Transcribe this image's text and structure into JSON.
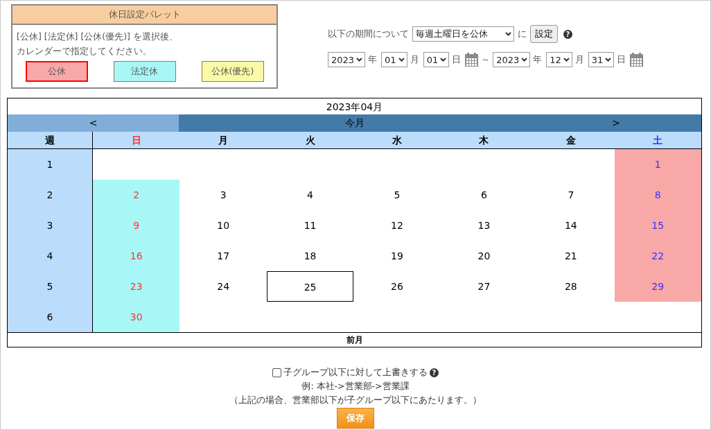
{
  "palette": {
    "title": "休日設定パレット",
    "instructions": [
      "[公休] [法定休] [公休(優先)] を選択後、",
      "カレンダーで指定してください。"
    ],
    "items": [
      {
        "kind": "public",
        "label": "公休",
        "color": "#f9a8a8",
        "selected": true
      },
      {
        "kind": "legal",
        "label": "法定休",
        "color": "#a8f7f7",
        "selected": false
      },
      {
        "kind": "priority",
        "label": "公休(優先)",
        "color": "#fafaa6",
        "selected": false
      }
    ]
  },
  "period": {
    "label": "以下の期間について",
    "rule": "毎週土曜日を公休",
    "connector": "に",
    "set_button": "設定",
    "help": "?",
    "start": [
      {
        "value": "2023",
        "unit": "年"
      },
      {
        "value": "01",
        "unit": "月"
      },
      {
        "value": "01",
        "unit": "日"
      }
    ],
    "separator": "～",
    "end": [
      {
        "value": "2023",
        "unit": "年"
      },
      {
        "value": "12",
        "unit": "月"
      },
      {
        "value": "31",
        "unit": "日"
      }
    ]
  },
  "calendar": {
    "title": "2023年04月",
    "prev": "<",
    "today_button": "今月",
    "next": ">",
    "week_header": "週",
    "weekdays": [
      {
        "kind": "sun",
        "label": "日",
        "color": "#ff3333"
      },
      {
        "kind": "mon",
        "label": "月",
        "color": "#000000"
      },
      {
        "kind": "tue",
        "label": "火",
        "color": "#000000"
      },
      {
        "kind": "wed",
        "label": "水",
        "color": "#000000"
      },
      {
        "kind": "thu",
        "label": "木",
        "color": "#000000"
      },
      {
        "kind": "fri",
        "label": "金",
        "color": "#000000"
      },
      {
        "kind": "sat",
        "label": "土",
        "color": "#3333ff"
      }
    ],
    "weeks": [
      {
        "week": "1",
        "days": [
          {
            "kind": "sat",
            "day": "1",
            "public_holiday": true,
            "legal_holiday": false,
            "today": false
          }
        ]
      },
      {
        "week": "2",
        "days": [
          {
            "kind": "sun",
            "day": "2",
            "public_holiday": false,
            "legal_holiday": true,
            "today": false
          },
          {
            "kind": "mon",
            "day": "3",
            "public_holiday": false,
            "legal_holiday": false,
            "today": false
          },
          {
            "kind": "tue",
            "day": "4",
            "public_holiday": false,
            "legal_holiday": false,
            "today": false
          },
          {
            "kind": "wed",
            "day": "5",
            "public_holiday": false,
            "legal_holiday": false,
            "today": false
          },
          {
            "kind": "thu",
            "day": "6",
            "public_holiday": false,
            "legal_holiday": false,
            "today": false
          },
          {
            "kind": "fri",
            "day": "7",
            "public_holiday": false,
            "legal_holiday": false,
            "today": false
          },
          {
            "kind": "sat",
            "day": "8",
            "public_holiday": true,
            "legal_holiday": false,
            "today": false
          }
        ]
      },
      {
        "week": "3",
        "days": [
          {
            "kind": "sun",
            "day": "9",
            "public_holiday": false,
            "legal_holiday": true,
            "today": false
          },
          {
            "kind": "mon",
            "day": "10",
            "public_holiday": false,
            "legal_holiday": false,
            "today": false
          },
          {
            "kind": "tue",
            "day": "11",
            "public_holiday": false,
            "legal_holiday": false,
            "today": false
          },
          {
            "kind": "wed",
            "day": "12",
            "public_holiday": false,
            "legal_holiday": false,
            "today": false
          },
          {
            "kind": "thu",
            "day": "13",
            "public_holiday": false,
            "legal_holiday": false,
            "today": false
          },
          {
            "kind": "fri",
            "day": "14",
            "public_holiday": false,
            "legal_holiday": false,
            "today": false
          },
          {
            "kind": "sat",
            "day": "15",
            "public_holiday": true,
            "legal_holiday": false,
            "today": false
          }
        ]
      },
      {
        "week": "4",
        "days": [
          {
            "kind": "sun",
            "day": "16",
            "public_holiday": false,
            "legal_holiday": true,
            "today": false
          },
          {
            "kind": "mon",
            "day": "17",
            "public_holiday": false,
            "legal_holiday": false,
            "today": false
          },
          {
            "kind": "tue",
            "day": "18",
            "public_holiday": false,
            "legal_holiday": false,
            "today": false
          },
          {
            "kind": "wed",
            "day": "19",
            "public_holiday": false,
            "legal_holiday": false,
            "today": false
          },
          {
            "kind": "thu",
            "day": "20",
            "public_holiday": false,
            "legal_holiday": false,
            "today": false
          },
          {
            "kind": "fri",
            "day": "21",
            "public_holiday": false,
            "legal_holiday": false,
            "today": false
          },
          {
            "kind": "sat",
            "day": "22",
            "public_holiday": true,
            "legal_holiday": false,
            "today": false
          }
        ]
      },
      {
        "week": "5",
        "days": [
          {
            "kind": "sun",
            "day": "23",
            "public_holiday": false,
            "legal_holiday": true,
            "today": false
          },
          {
            "kind": "mon",
            "day": "24",
            "public_holiday": false,
            "legal_holiday": false,
            "today": false
          },
          {
            "kind": "tue",
            "day": "25",
            "public_holiday": false,
            "legal_holiday": false,
            "today": true
          },
          {
            "kind": "wed",
            "day": "26",
            "public_holiday": false,
            "legal_holiday": false,
            "today": false
          },
          {
            "kind": "thu",
            "day": "27",
            "public_holiday": false,
            "legal_holiday": false,
            "today": false
          },
          {
            "kind": "fri",
            "day": "28",
            "public_holiday": false,
            "legal_holiday": false,
            "today": false
          },
          {
            "kind": "sat",
            "day": "29",
            "public_holiday": true,
            "legal_holiday": false,
            "today": false
          }
        ]
      },
      {
        "week": "6",
        "days": [
          {
            "kind": "sun",
            "day": "30",
            "public_holiday": false,
            "legal_holiday": true,
            "today": false
          }
        ]
      }
    ],
    "footer": "前月"
  },
  "options": {
    "overwrite": {
      "label": "子グループ以下に対して上書きする",
      "checked": false
    },
    "help": "?",
    "example": "例: 本社->営業部->営業課",
    "note": "（上記の場合、営業部以下が子グループ以下にあたります。）",
    "save_button": "保存"
  }
}
